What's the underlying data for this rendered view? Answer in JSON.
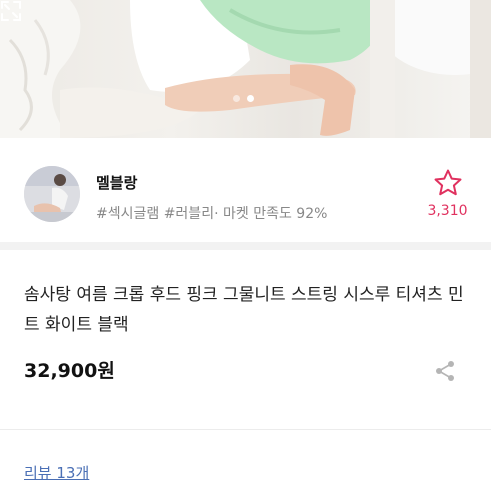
{
  "gallery": {
    "page_count": 2,
    "active_page": 2,
    "expand_icon": "expand-icon"
  },
  "seller": {
    "name": "멜블랑",
    "tags": "#섹시글램 #러블리",
    "separator": "·",
    "rating_text": "마켓 만족도 92%",
    "favorite_icon": "star-outline-icon",
    "favorite_count": "3,310",
    "accent_color": "#e0315f"
  },
  "product": {
    "title": "솜사탕 여름 크롭 후드 핑크 그물니트 스트링 시스루 티셔츠 민트 화이트 블랙",
    "price": "32,900원",
    "share_icon": "share-icon"
  },
  "reviews": {
    "link_text": "리뷰 13개",
    "link_color": "#4a6fb5"
  }
}
